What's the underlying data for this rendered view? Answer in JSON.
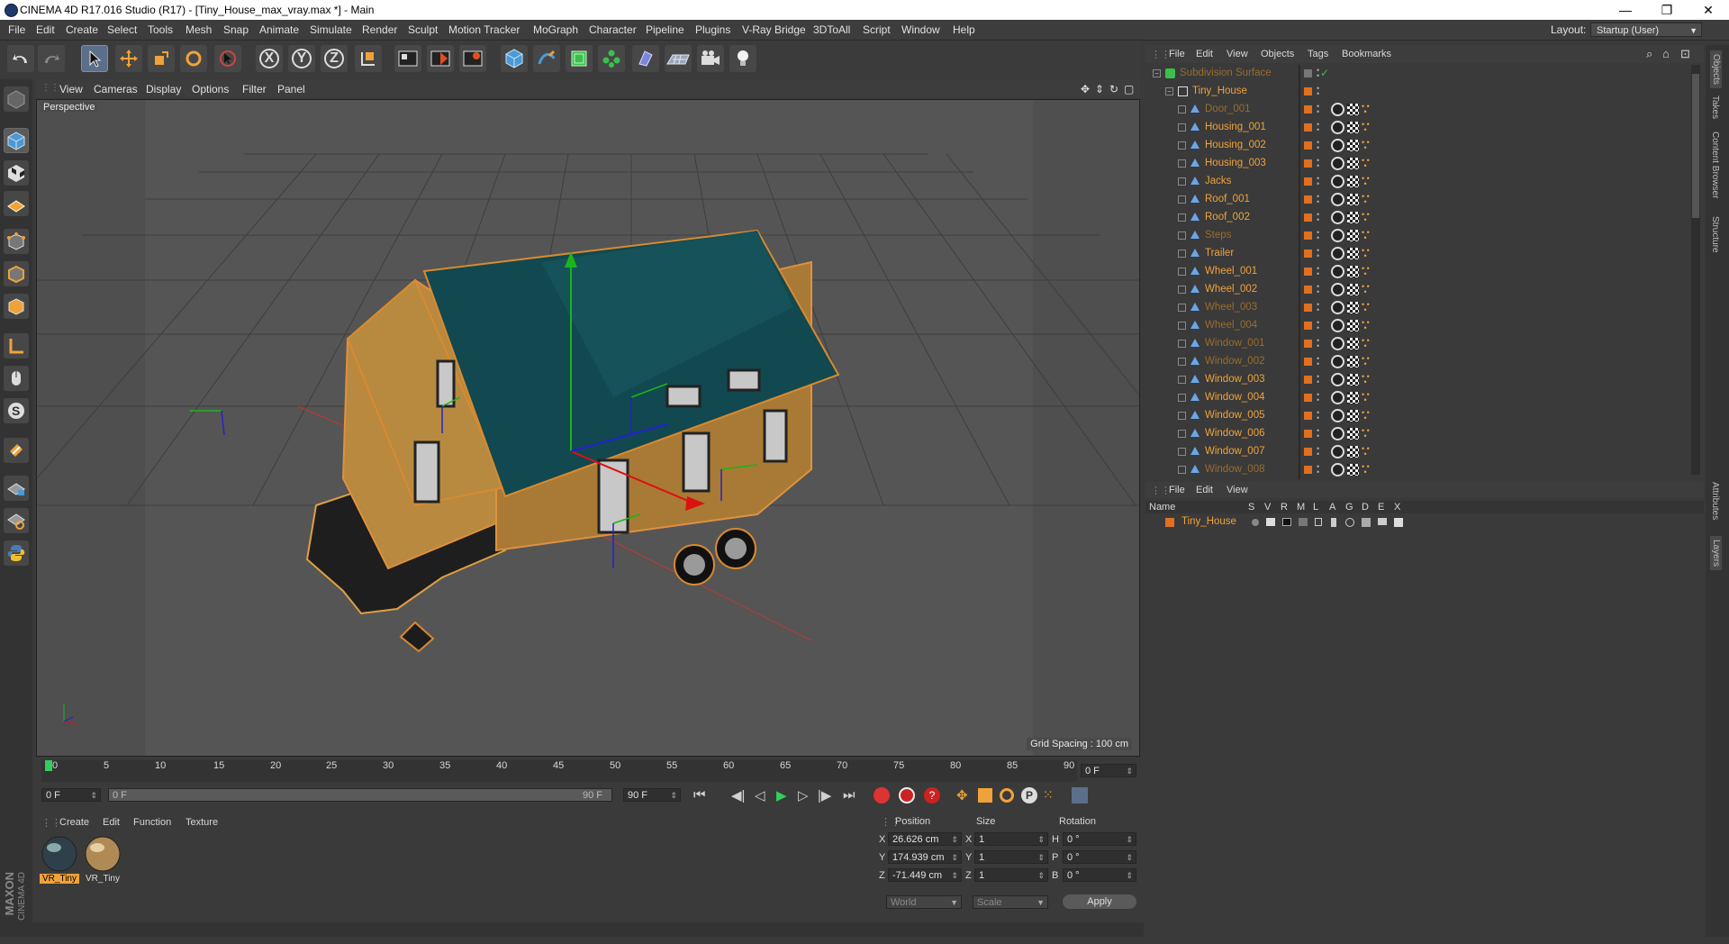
{
  "window": {
    "title": "CINEMA 4D R17.016 Studio (R17) - [Tiny_House_max_vray.max *] - Main",
    "minimize": "—",
    "maximize": "❐",
    "close": "✕"
  },
  "menubar": {
    "items": [
      "File",
      "Edit",
      "Create",
      "Select",
      "Tools",
      "Mesh",
      "Snap",
      "Animate",
      "Simulate",
      "Render",
      "Sculpt",
      "Motion Tracker",
      "MoGraph",
      "Character",
      "Pipeline",
      "Plugins",
      "V-Ray Bridge",
      "3DToAll",
      "Script",
      "Window",
      "Help"
    ],
    "layout_label": "Layout:",
    "layout_value": "Startup (User)"
  },
  "toolbar": {
    "icons": [
      "undo-icon",
      "redo-icon",
      "select-icon",
      "move-icon",
      "scale-icon",
      "rotate-icon",
      "live-select-icon",
      "x-axis-icon",
      "y-axis-icon",
      "z-axis-icon",
      "world-coords-icon",
      "render-view-icon",
      "render-picture-viewer-icon",
      "edit-render-settings-icon",
      "cube-icon",
      "pen-icon",
      "subdivision-icon",
      "array-icon",
      "deformer-icon",
      "floor-icon",
      "camera-icon",
      "light-icon"
    ],
    "axes": [
      "X",
      "Y",
      "Z"
    ]
  },
  "viewport": {
    "menu": [
      "View",
      "Cameras",
      "Display",
      "Options",
      "Filter",
      "Panel"
    ],
    "camera_label": "Perspective",
    "grid_spacing": "Grid Spacing : 100 cm"
  },
  "timeline": {
    "ticks": [
      "0",
      "5",
      "10",
      "15",
      "20",
      "25",
      "30",
      "35",
      "40",
      "45",
      "50",
      "55",
      "60",
      "65",
      "70",
      "75",
      "80",
      "85",
      "90"
    ],
    "current_frame": "0 F",
    "start_field": "0 F",
    "range_start": "0 F",
    "range_end": "90 F",
    "end_field": "90 F"
  },
  "material_manager": {
    "menu": [
      "Create",
      "Edit",
      "Function",
      "Texture"
    ],
    "materials": [
      {
        "name": "VR_Tiny"
      },
      {
        "name": "VR_Tiny"
      }
    ]
  },
  "coordinates": {
    "headers": [
      "Position",
      "Size",
      "Rotation"
    ],
    "rows": [
      {
        "axis": "X",
        "pos": "26.626 cm",
        "size_axis": "X",
        "size": "1",
        "rot_axis": "H",
        "rot": "0 °"
      },
      {
        "axis": "Y",
        "pos": "174.939 cm",
        "size_axis": "Y",
        "size": "1",
        "rot_axis": "P",
        "rot": "0 °"
      },
      {
        "axis": "Z",
        "pos": "-71.449 cm",
        "size_axis": "Z",
        "size": "1",
        "rot_axis": "B",
        "rot": "0 °"
      }
    ],
    "mode": "World",
    "scale": "Scale",
    "apply": "Apply"
  },
  "object_manager": {
    "menu": [
      "File",
      "Edit",
      "View",
      "Objects",
      "Tags",
      "Bookmarks"
    ],
    "objects": [
      {
        "name": "Subdivision Surface",
        "dim": true,
        "depth": 0,
        "icon": "subdivision-icon"
      },
      {
        "name": "Tiny_House",
        "dim": false,
        "depth": 1,
        "icon": "null-icon"
      },
      {
        "name": "Door_001",
        "dim": true,
        "depth": 2
      },
      {
        "name": "Housing_001",
        "dim": false,
        "depth": 2
      },
      {
        "name": "Housing_002",
        "dim": false,
        "depth": 2
      },
      {
        "name": "Housing_003",
        "dim": false,
        "depth": 2
      },
      {
        "name": "Jacks",
        "dim": false,
        "depth": 2
      },
      {
        "name": "Roof_001",
        "dim": false,
        "depth": 2
      },
      {
        "name": "Roof_002",
        "dim": false,
        "depth": 2
      },
      {
        "name": "Steps",
        "dim": true,
        "depth": 2
      },
      {
        "name": "Trailer",
        "dim": false,
        "depth": 2
      },
      {
        "name": "Wheel_001",
        "dim": false,
        "depth": 2
      },
      {
        "name": "Wheel_002",
        "dim": false,
        "depth": 2
      },
      {
        "name": "Wheel_003",
        "dim": true,
        "depth": 2
      },
      {
        "name": "Wheel_004",
        "dim": true,
        "depth": 2
      },
      {
        "name": "Window_001",
        "dim": true,
        "depth": 2
      },
      {
        "name": "Window_002",
        "dim": true,
        "depth": 2
      },
      {
        "name": "Window_003",
        "dim": false,
        "depth": 2
      },
      {
        "name": "Window_004",
        "dim": false,
        "depth": 2
      },
      {
        "name": "Window_005",
        "dim": false,
        "depth": 2
      },
      {
        "name": "Window_006",
        "dim": false,
        "depth": 2
      },
      {
        "name": "Window_007",
        "dim": false,
        "depth": 2
      },
      {
        "name": "Window_008",
        "dim": true,
        "depth": 2
      }
    ]
  },
  "layer_manager": {
    "menu": [
      "File",
      "Edit",
      "View"
    ],
    "columns": [
      "Name",
      "S",
      "V",
      "R",
      "M",
      "L",
      "A",
      "G",
      "D",
      "E",
      "X"
    ],
    "layers": [
      {
        "name": "Tiny_House",
        "color": "#e07020"
      }
    ]
  },
  "right_tabs": [
    "Objects",
    "Takes",
    "Content Browser",
    "Structure",
    "Attributes",
    "Layers"
  ],
  "branding": {
    "maxon": "MAXON",
    "product": "CINEMA 4D"
  },
  "colors": {
    "accent_orange": "#f0a23a",
    "selection_blue": "#5c6f8a",
    "viewport_bg": "#515151"
  }
}
